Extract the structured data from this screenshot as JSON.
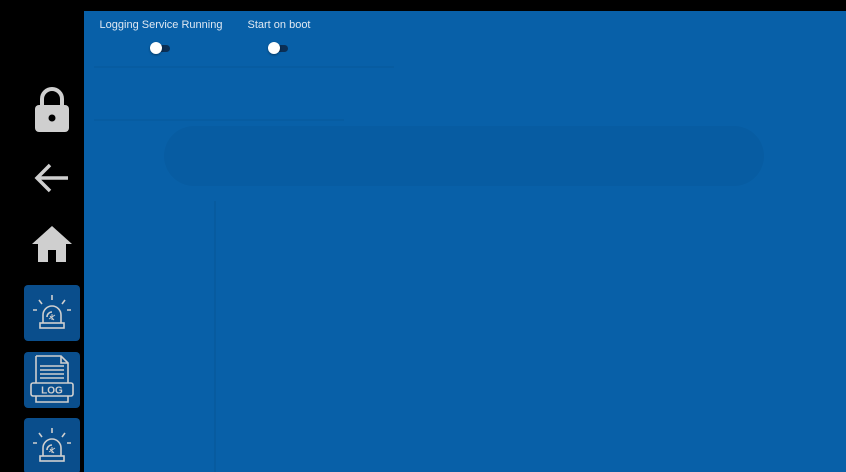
{
  "toggles": {
    "logging": {
      "label": "Logging Service Running",
      "on": false
    },
    "boot": {
      "label": "Start on boot",
      "on": false
    }
  },
  "sidebar": {
    "items": [
      {
        "name": "lock",
        "icon": "lock-icon"
      },
      {
        "name": "back",
        "icon": "arrow-left-icon"
      },
      {
        "name": "home",
        "icon": "home-icon"
      },
      {
        "name": "alarm",
        "icon": "siren-icon"
      },
      {
        "name": "log",
        "icon": "log-file-icon",
        "label": "LOG"
      },
      {
        "name": "alarm-2",
        "icon": "siren-icon"
      }
    ]
  },
  "colors": {
    "panel_bg": "#0860a8",
    "sidebar_bg": "#000000",
    "tile_bg": "#0a4e8c",
    "icon_gray": "#cfcfcf"
  }
}
